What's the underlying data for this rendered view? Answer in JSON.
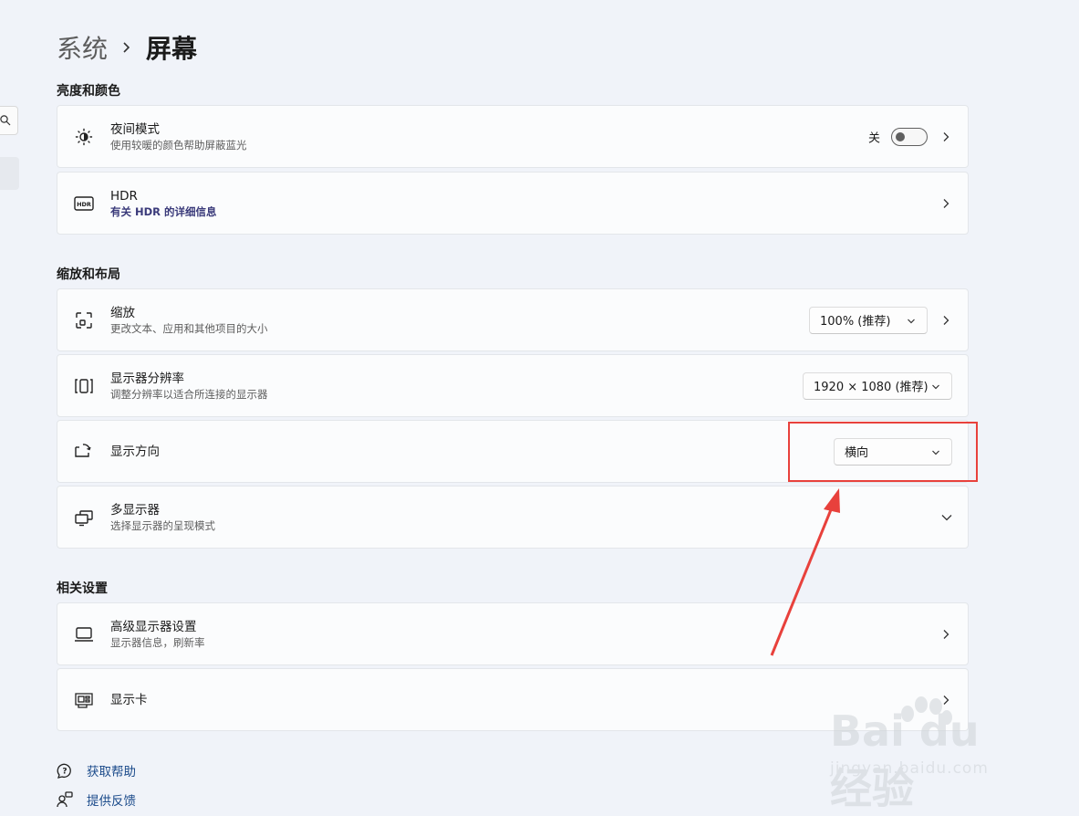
{
  "breadcrumb": {
    "parent": "系统",
    "current": "屏幕"
  },
  "sections": {
    "brightness": "亮度和颜色",
    "scale_layout": "缩放和布局",
    "related": "相关设置"
  },
  "night_mode": {
    "title": "夜间模式",
    "subtitle": "使用较暖的颜色帮助屏蔽蓝光",
    "toggle_label": "关",
    "toggle_on": false
  },
  "hdr": {
    "title": "HDR",
    "subtitle": "有关 HDR 的详细信息"
  },
  "scale": {
    "title": "缩放",
    "subtitle": "更改文本、应用和其他项目的大小",
    "value": "100% (推荐)"
  },
  "resolution": {
    "title": "显示器分辨率",
    "subtitle": "调整分辨率以适合所连接的显示器",
    "value": "1920 × 1080 (推荐)"
  },
  "orientation": {
    "title": "显示方向",
    "value": "横向"
  },
  "multi_display": {
    "title": "多显示器",
    "subtitle": "选择显示器的呈现模式"
  },
  "advanced_display": {
    "title": "高级显示器设置",
    "subtitle": "显示器信息，刷新率"
  },
  "graphics": {
    "title": "显示卡"
  },
  "footer": {
    "help": "获取帮助",
    "feedback": "提供反馈"
  },
  "watermark": {
    "brand": "Bai du 经验",
    "url": "jingyan.baidu.com"
  },
  "colors": {
    "highlight": "#e8413c",
    "link": "#1a4a8a",
    "background": "#f0f3f9",
    "card": "#fbfcfd"
  },
  "icons": [
    "search-icon",
    "chevron-right-icon",
    "brightness-icon",
    "hdr-icon",
    "scale-icon",
    "resolution-icon",
    "orientation-icon",
    "multi-display-icon",
    "monitor-icon",
    "graphics-card-icon",
    "help-icon",
    "feedback-icon",
    "chevron-down-icon"
  ]
}
